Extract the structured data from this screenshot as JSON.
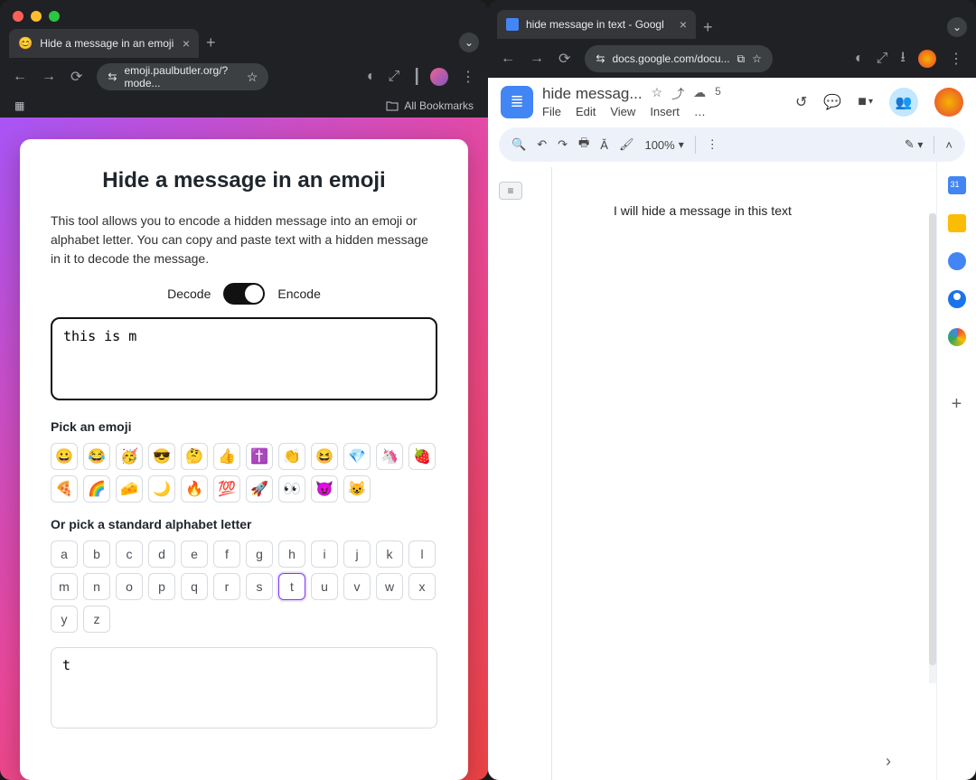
{
  "left_window": {
    "tab": {
      "favicon": "😊",
      "title": "Hide a message in an emoji"
    },
    "omnibox": {
      "lock_icon": "⇆",
      "url_text": "emoji.paulbutler.org/?mode..."
    },
    "bookmarks_bar": {
      "grid": "⊞⊞",
      "all_label": "All Bookmarks"
    },
    "card": {
      "heading": "Hide a message in an emoji",
      "description": "This tool allows you to encode a hidden message into an emoji or alphabet letter. You can copy and paste text with a hidden message in it to decode the message.",
      "toggle": {
        "left": "Decode",
        "right": "Encode",
        "state": "Encode"
      },
      "message_input": "this is m",
      "emoji_label": "Pick an emoji",
      "emojis": [
        "😀",
        "😂",
        "🥳",
        "😎",
        "🤔",
        "👍",
        "✝️",
        "👏",
        "😆",
        "💎",
        "🦄",
        "🍓",
        "🍕",
        "🌈",
        "🧀",
        "🌙",
        "🔥",
        "💯",
        "🚀",
        "👀",
        "😈",
        "😺"
      ],
      "letter_label": "Or pick a standard alphabet letter",
      "letters": [
        "a",
        "b",
        "c",
        "d",
        "e",
        "f",
        "g",
        "h",
        "i",
        "j",
        "k",
        "l",
        "m",
        "n",
        "o",
        "p",
        "q",
        "r",
        "s",
        "t",
        "u",
        "v",
        "w",
        "x",
        "y",
        "z"
      ],
      "selected_letter": "t",
      "output_value": "t"
    }
  },
  "right_window": {
    "tab": {
      "title": "hide message in text - Googl"
    },
    "omnibox": {
      "url_text": "docs.google.com/docu..."
    },
    "docs": {
      "title": "hide messag...",
      "cloud_badge": "5",
      "menus": [
        "File",
        "Edit",
        "View",
        "Insert",
        "…"
      ],
      "toolbar": {
        "zoom": "100%"
      },
      "body_text": "I will hide a message in this text"
    }
  }
}
